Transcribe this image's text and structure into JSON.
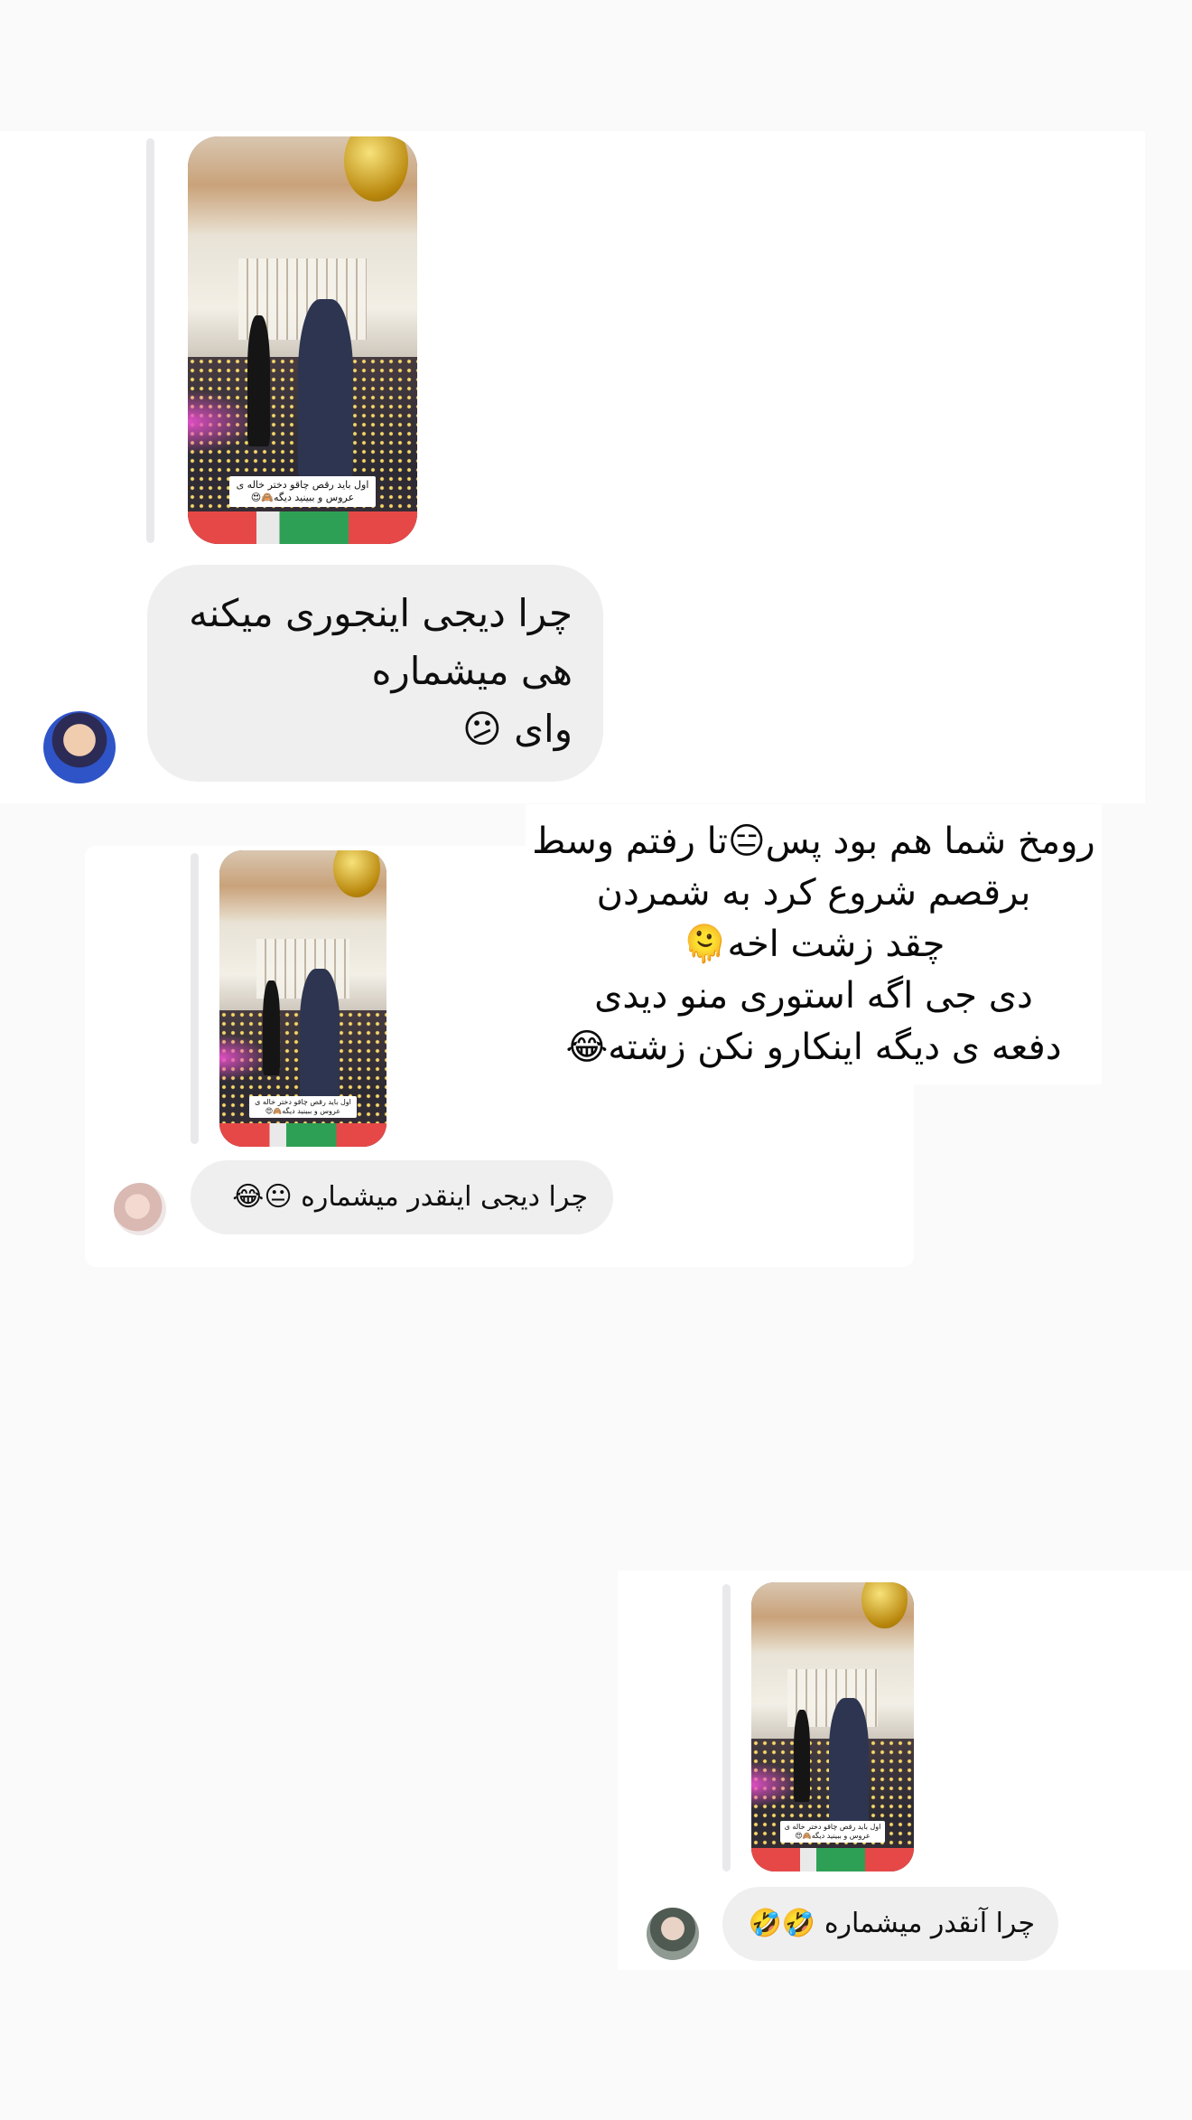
{
  "story_overlay": {
    "lines": [
      "رومخ شما هم بود پس😑تا رفتم وسط",
      "برقصم شروع کرد به شمردن",
      "چقد زشت اخه🫠",
      "دی جی اگه استوری منو دیدی",
      "دفعه ی دیگه اینکارو نکن زشته😂"
    ]
  },
  "replies": [
    {
      "story_caption_line1": "اول باید رقص چاقو دختر خاله ی",
      "story_caption_line2": "عروس و ببینید دیگه🙈😍",
      "message_line1": "چرا دیجی اینجوری میکنه",
      "message_line2": "هی میشماره",
      "message_line3": "وای 😕",
      "avatar_icon": "user-avatar"
    },
    {
      "story_caption_line1": "اول باید رقص چاقو دختر خاله ی",
      "story_caption_line2": "عروس و ببینید دیگه🙈😍",
      "message": "چرا دیجی اینقدر میشماره 😐😂",
      "avatar_icon": "user-avatar"
    },
    {
      "story_caption_line1": "اول باید رقص چاقو دختر خاله ی",
      "story_caption_line2": "عروس و ببینید دیگه🙈😍",
      "message": "چرا آنقدر میشماره 🤣🤣",
      "avatar_icon": "user-avatar"
    }
  ],
  "colors": {
    "background": "#fafafa",
    "card": "#ffffff",
    "bubble": "#efefef",
    "reply_bar": "#e9e9ec"
  }
}
